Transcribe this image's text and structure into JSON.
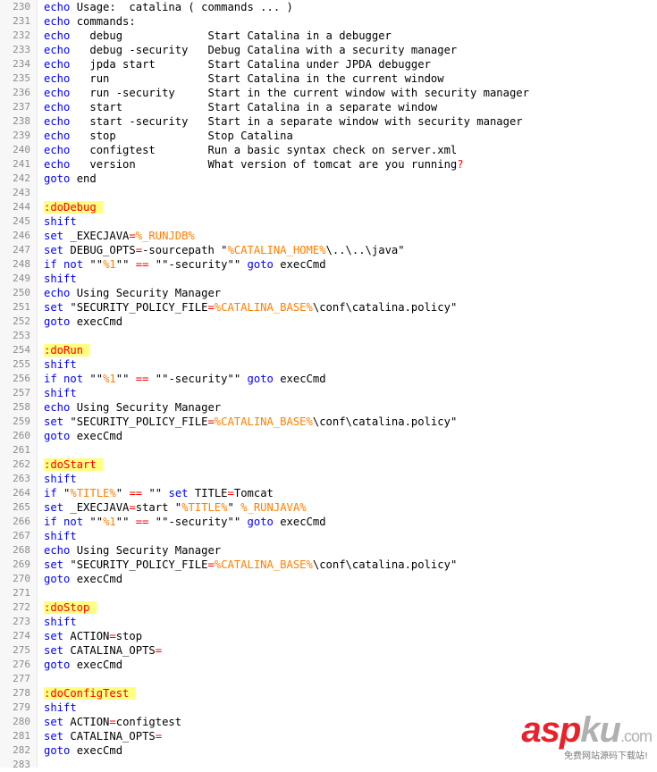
{
  "colors": {
    "keyword": "#0000ff",
    "variable": "#ff8000",
    "operator": "#ff0000",
    "label_bg": "#ffff80",
    "label_fg": "#ff0000",
    "text": "#000000",
    "line_number": "#8c8c8c"
  },
  "editor": {
    "lines": [
      {
        "num": "230",
        "tokens": [
          [
            "kw",
            "echo"
          ],
          [
            "t",
            " Usage:  catalina ( commands ... )"
          ]
        ]
      },
      {
        "num": "231",
        "tokens": [
          [
            "kw",
            "echo"
          ],
          [
            "t",
            " commands:"
          ]
        ]
      },
      {
        "num": "232",
        "tokens": [
          [
            "kw",
            "echo"
          ],
          [
            "t",
            "   debug             Start Catalina in a debugger"
          ]
        ]
      },
      {
        "num": "233",
        "tokens": [
          [
            "kw",
            "echo"
          ],
          [
            "t",
            "   debug -security   Debug Catalina with a security manager"
          ]
        ]
      },
      {
        "num": "234",
        "tokens": [
          [
            "kw",
            "echo"
          ],
          [
            "t",
            "   jpda start        Start Catalina under JPDA debugger"
          ]
        ]
      },
      {
        "num": "235",
        "tokens": [
          [
            "kw",
            "echo"
          ],
          [
            "t",
            "   run               Start Catalina in the current window"
          ]
        ]
      },
      {
        "num": "236",
        "tokens": [
          [
            "kw",
            "echo"
          ],
          [
            "t",
            "   run -security     Start in the current window with security manager"
          ]
        ]
      },
      {
        "num": "237",
        "tokens": [
          [
            "kw",
            "echo"
          ],
          [
            "t",
            "   start             Start Catalina in a separate window"
          ]
        ]
      },
      {
        "num": "238",
        "tokens": [
          [
            "kw",
            "echo"
          ],
          [
            "t",
            "   start -security   Start in a separate window with security manager"
          ]
        ]
      },
      {
        "num": "239",
        "tokens": [
          [
            "kw",
            "echo"
          ],
          [
            "t",
            "   stop              Stop Catalina"
          ]
        ]
      },
      {
        "num": "240",
        "tokens": [
          [
            "kw",
            "echo"
          ],
          [
            "t",
            "   configtest        Run a basic syntax check on server.xml"
          ]
        ]
      },
      {
        "num": "241",
        "tokens": [
          [
            "kw",
            "echo"
          ],
          [
            "t",
            "   version           What version of tomcat are you running"
          ],
          [
            "op",
            "?"
          ]
        ]
      },
      {
        "num": "242",
        "tokens": [
          [
            "kw",
            "goto"
          ],
          [
            "t",
            " end"
          ]
        ]
      },
      {
        "num": "243",
        "tokens": []
      },
      {
        "num": "244",
        "tokens": [
          [
            "label",
            ":doDebug "
          ]
        ]
      },
      {
        "num": "245",
        "tokens": [
          [
            "kw",
            "shift"
          ]
        ]
      },
      {
        "num": "246",
        "tokens": [
          [
            "kw",
            "set"
          ],
          [
            "t",
            " _EXECJAVA"
          ],
          [
            "op",
            "="
          ],
          [
            "var",
            "%_RUNJDB%"
          ]
        ]
      },
      {
        "num": "247",
        "tokens": [
          [
            "kw",
            "set"
          ],
          [
            "t",
            " DEBUG_OPTS"
          ],
          [
            "op",
            "="
          ],
          [
            "t",
            "-sourcepath \""
          ],
          [
            "var",
            "%CATALINA_HOME%"
          ],
          [
            "t",
            "\\..\\..\\java\""
          ]
        ]
      },
      {
        "num": "248",
        "tokens": [
          [
            "kw",
            "if"
          ],
          [
            "t",
            " "
          ],
          [
            "kw",
            "not"
          ],
          [
            "t",
            " \"\""
          ],
          [
            "var",
            "%1"
          ],
          [
            "t",
            "\"\" "
          ],
          [
            "op",
            "=="
          ],
          [
            "t",
            " \"\"-security\"\" "
          ],
          [
            "kw",
            "goto"
          ],
          [
            "t",
            " execCmd"
          ]
        ]
      },
      {
        "num": "249",
        "tokens": [
          [
            "kw",
            "shift"
          ]
        ]
      },
      {
        "num": "250",
        "tokens": [
          [
            "kw",
            "echo"
          ],
          [
            "t",
            " Using Security Manager"
          ]
        ]
      },
      {
        "num": "251",
        "tokens": [
          [
            "kw",
            "set"
          ],
          [
            "t",
            " \"SECURITY_POLICY_FILE"
          ],
          [
            "op",
            "="
          ],
          [
            "var",
            "%CATALINA_BASE%"
          ],
          [
            "t",
            "\\conf\\catalina.policy\""
          ]
        ]
      },
      {
        "num": "252",
        "tokens": [
          [
            "kw",
            "goto"
          ],
          [
            "t",
            " execCmd"
          ]
        ]
      },
      {
        "num": "253",
        "tokens": []
      },
      {
        "num": "254",
        "tokens": [
          [
            "label",
            ":doRun "
          ]
        ]
      },
      {
        "num": "255",
        "tokens": [
          [
            "kw",
            "shift"
          ]
        ]
      },
      {
        "num": "256",
        "tokens": [
          [
            "kw",
            "if"
          ],
          [
            "t",
            " "
          ],
          [
            "kw",
            "not"
          ],
          [
            "t",
            " \"\""
          ],
          [
            "var",
            "%1"
          ],
          [
            "t",
            "\"\" "
          ],
          [
            "op",
            "=="
          ],
          [
            "t",
            " \"\"-security\"\" "
          ],
          [
            "kw",
            "goto"
          ],
          [
            "t",
            " execCmd"
          ]
        ]
      },
      {
        "num": "257",
        "tokens": [
          [
            "kw",
            "shift"
          ]
        ]
      },
      {
        "num": "258",
        "tokens": [
          [
            "kw",
            "echo"
          ],
          [
            "t",
            " Using Security Manager"
          ]
        ]
      },
      {
        "num": "259",
        "tokens": [
          [
            "kw",
            "set"
          ],
          [
            "t",
            " \"SECURITY_POLICY_FILE"
          ],
          [
            "op",
            "="
          ],
          [
            "var",
            "%CATALINA_BASE%"
          ],
          [
            "t",
            "\\conf\\catalina.policy\""
          ]
        ]
      },
      {
        "num": "260",
        "tokens": [
          [
            "kw",
            "goto"
          ],
          [
            "t",
            " execCmd"
          ]
        ]
      },
      {
        "num": "261",
        "tokens": []
      },
      {
        "num": "262",
        "tokens": [
          [
            "label",
            ":doStart "
          ]
        ]
      },
      {
        "num": "263",
        "tokens": [
          [
            "kw",
            "shift"
          ]
        ]
      },
      {
        "num": "264",
        "tokens": [
          [
            "kw",
            "if"
          ],
          [
            "t",
            " \""
          ],
          [
            "var",
            "%TITLE%"
          ],
          [
            "t",
            "\" "
          ],
          [
            "op",
            "=="
          ],
          [
            "t",
            " \"\" "
          ],
          [
            "kw",
            "set"
          ],
          [
            "t",
            " TITLE"
          ],
          [
            "op",
            "="
          ],
          [
            "t",
            "Tomcat"
          ]
        ]
      },
      {
        "num": "265",
        "tokens": [
          [
            "kw",
            "set"
          ],
          [
            "t",
            " _EXECJAVA"
          ],
          [
            "op",
            "="
          ],
          [
            "t",
            "start \""
          ],
          [
            "var",
            "%TITLE%"
          ],
          [
            "t",
            "\" "
          ],
          [
            "var",
            "%_RUNJAVA%"
          ]
        ]
      },
      {
        "num": "266",
        "tokens": [
          [
            "kw",
            "if"
          ],
          [
            "t",
            " "
          ],
          [
            "kw",
            "not"
          ],
          [
            "t",
            " \"\""
          ],
          [
            "var",
            "%1"
          ],
          [
            "t",
            "\"\" "
          ],
          [
            "op",
            "=="
          ],
          [
            "t",
            " \"\"-security\"\" "
          ],
          [
            "kw",
            "goto"
          ],
          [
            "t",
            " execCmd"
          ]
        ]
      },
      {
        "num": "267",
        "tokens": [
          [
            "kw",
            "shift"
          ]
        ]
      },
      {
        "num": "268",
        "tokens": [
          [
            "kw",
            "echo"
          ],
          [
            "t",
            " Using Security Manager"
          ]
        ]
      },
      {
        "num": "269",
        "tokens": [
          [
            "kw",
            "set"
          ],
          [
            "t",
            " \"SECURITY_POLICY_FILE"
          ],
          [
            "op",
            "="
          ],
          [
            "var",
            "%CATALINA_BASE%"
          ],
          [
            "t",
            "\\conf\\catalina.policy\""
          ]
        ]
      },
      {
        "num": "270",
        "tokens": [
          [
            "kw",
            "goto"
          ],
          [
            "t",
            " execCmd"
          ]
        ]
      },
      {
        "num": "271",
        "tokens": []
      },
      {
        "num": "272",
        "tokens": [
          [
            "label",
            ":doStop "
          ]
        ]
      },
      {
        "num": "273",
        "tokens": [
          [
            "kw",
            "shift"
          ]
        ]
      },
      {
        "num": "274",
        "tokens": [
          [
            "kw",
            "set"
          ],
          [
            "t",
            " ACTION"
          ],
          [
            "op",
            "="
          ],
          [
            "t",
            "stop"
          ]
        ]
      },
      {
        "num": "275",
        "tokens": [
          [
            "kw",
            "set"
          ],
          [
            "t",
            " CATALINA_OPTS"
          ],
          [
            "op",
            "="
          ]
        ]
      },
      {
        "num": "276",
        "tokens": [
          [
            "kw",
            "goto"
          ],
          [
            "t",
            " execCmd"
          ]
        ]
      },
      {
        "num": "277",
        "tokens": []
      },
      {
        "num": "278",
        "tokens": [
          [
            "label",
            ":doConfigTest "
          ]
        ]
      },
      {
        "num": "279",
        "tokens": [
          [
            "kw",
            "shift"
          ]
        ]
      },
      {
        "num": "280",
        "tokens": [
          [
            "kw",
            "set"
          ],
          [
            "t",
            " ACTION"
          ],
          [
            "op",
            "="
          ],
          [
            "t",
            "configtest"
          ]
        ]
      },
      {
        "num": "281",
        "tokens": [
          [
            "kw",
            "set"
          ],
          [
            "t",
            " CATALINA_OPTS"
          ],
          [
            "op",
            "="
          ]
        ]
      },
      {
        "num": "282",
        "tokens": [
          [
            "kw",
            "goto"
          ],
          [
            "t",
            " execCmd"
          ]
        ]
      },
      {
        "num": "283",
        "tokens": []
      }
    ]
  },
  "watermark": {
    "brand_asp": "asp",
    "brand_ku": "ku",
    "brand_com": ".com",
    "subtitle": "免费网站源码下载站!"
  }
}
